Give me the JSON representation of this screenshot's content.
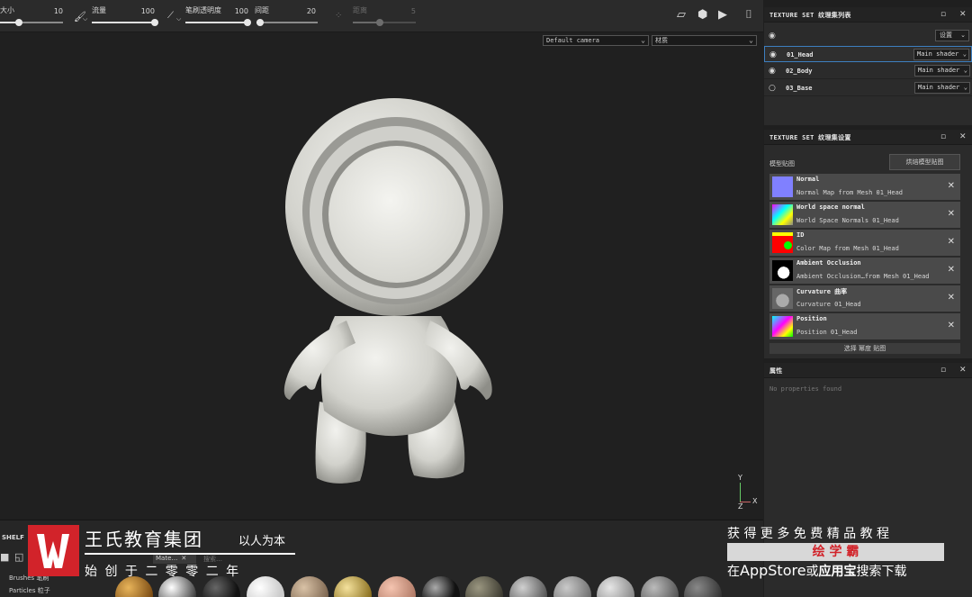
{
  "toolbar": {
    "size_label": "大小",
    "size_value": "10",
    "flow_label": "流量",
    "flow_value": "100",
    "opacity_label": "笔刷透明度",
    "opacity_value": "100",
    "spacing_label": "间距",
    "spacing_value": "20",
    "distance_label": "距离",
    "distance_value": "5"
  },
  "viewport": {
    "camera_select": "Default camera",
    "material_select": "材质",
    "axis_y": "Y",
    "axis_x": "X",
    "axis_z": "Z"
  },
  "texture_set_list": {
    "title": "TEXTURE SET 纹理集列表",
    "settings_button": "设置",
    "items": [
      {
        "name": "01_Head",
        "shader": "Main shader",
        "selected": true,
        "visible": true
      },
      {
        "name": "02_Body",
        "shader": "Main shader",
        "selected": false,
        "visible": true
      },
      {
        "name": "03_Base",
        "shader": "Main shader",
        "selected": false,
        "visible": false
      }
    ]
  },
  "texture_set_settings": {
    "title": "TEXTURE SET 纹理集设置",
    "mesh_maps_label": "模型贴图",
    "bake_button": "烘焙模型贴图",
    "maps": [
      {
        "name": "Normal",
        "desc": "Normal Map from Mesh 01_Head",
        "thumb_color": "#8080ff"
      },
      {
        "name": "World space normal",
        "desc": "World Space Normals 01_Head",
        "thumb_color": "#7f9fd0"
      },
      {
        "name": "ID",
        "desc": "Color Map from Mesh 01_Head",
        "thumb_color": "#ff0000"
      },
      {
        "name": "Ambient Occlusion",
        "desc": "Ambient Occlusion…from Mesh 01_Head",
        "thumb_color": "#d0d0d0"
      },
      {
        "name": "Curvature 曲率",
        "desc": "Curvature 01_Head",
        "thumb_color": "#808080"
      },
      {
        "name": "Position",
        "desc": "Position 01_Head",
        "thumb_color": "#a070d0"
      }
    ],
    "select_button": "选择 幂度 贴图"
  },
  "properties": {
    "title": "属性",
    "empty_text": "No properties found"
  },
  "shelf": {
    "title": "SHELF",
    "tab_label": "Mate…",
    "search_placeholder": "搜索…",
    "categories": [
      "Brushes 笔刷",
      "Particles 粒子"
    ]
  },
  "watermark": {
    "company": "王氏教育集团",
    "slogan": "以人为本",
    "founded": "始 创 于 二 零 零 二 年",
    "promo_line1": "获 得 更 多 免 费 精 品 教 程",
    "promo_brand": "绘 学 霸",
    "promo_line2_prefix": "在",
    "promo_line2_store": "AppStore",
    "promo_line2_or": "或",
    "promo_line2_app": "应用宝",
    "promo_line2_suffix": "搜索下载"
  },
  "colors": {
    "accent_blue": "#3d7fc0",
    "watermark_red": "#d2232a",
    "panel_bg": "#2b2b2b",
    "viewport_bg": "#202020"
  }
}
